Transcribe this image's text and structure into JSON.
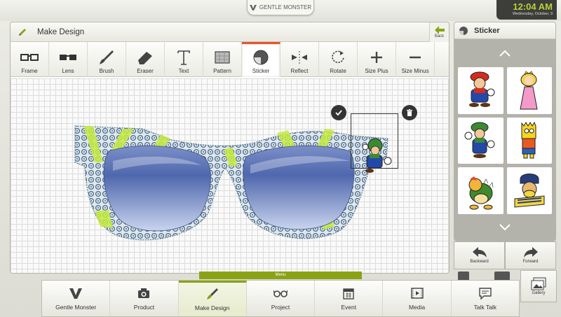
{
  "header": {
    "brand": "GENTLE MONSTER",
    "time": "12:04 AM",
    "date": "Wednesday, October, 9"
  },
  "main": {
    "title": "Make Design",
    "back_label": "Back",
    "tools": [
      {
        "label": "Frame",
        "icon": "frame-icon"
      },
      {
        "label": "Lens",
        "icon": "lens-icon"
      },
      {
        "label": "Brush",
        "icon": "brush-icon"
      },
      {
        "label": "Eraser",
        "icon": "eraser-icon"
      },
      {
        "label": "Text",
        "icon": "text-icon"
      },
      {
        "label": "Pattern",
        "icon": "pattern-icon"
      },
      {
        "label": "Sticker",
        "icon": "sticker-icon",
        "active": true
      },
      {
        "label": "Reflect",
        "icon": "reflect-icon"
      },
      {
        "label": "Rotate",
        "icon": "rotate-icon"
      },
      {
        "label": "Size Plus",
        "icon": "plus-icon"
      },
      {
        "label": "Size Minus",
        "icon": "minus-icon"
      }
    ],
    "menu_tab": "Menu"
  },
  "side": {
    "title": "Sticker",
    "stickers": [
      "mario-sticker",
      "princess-sticker",
      "luigi-sticker",
      "bart-sticker",
      "bowser-sticker",
      "boozers-sticker"
    ],
    "backward_label": "Backward",
    "forward_label": "Forward",
    "gallery_label": "Gallery"
  },
  "nav": [
    {
      "label": "Gentle Monster",
      "icon": "monster-logo-icon"
    },
    {
      "label": "Product",
      "icon": "camera-icon"
    },
    {
      "label": "Make Design",
      "icon": "brush-icon",
      "active": true
    },
    {
      "label": "Project",
      "icon": "glasses-icon"
    },
    {
      "label": "Event",
      "icon": "calendar-icon"
    },
    {
      "label": "Media",
      "icon": "film-icon"
    },
    {
      "label": "Talk Talk",
      "icon": "chat-icon"
    }
  ],
  "colors": {
    "accent": "#8aa314",
    "active_tool": "#e8542a",
    "clock_text": "#b8d234"
  }
}
